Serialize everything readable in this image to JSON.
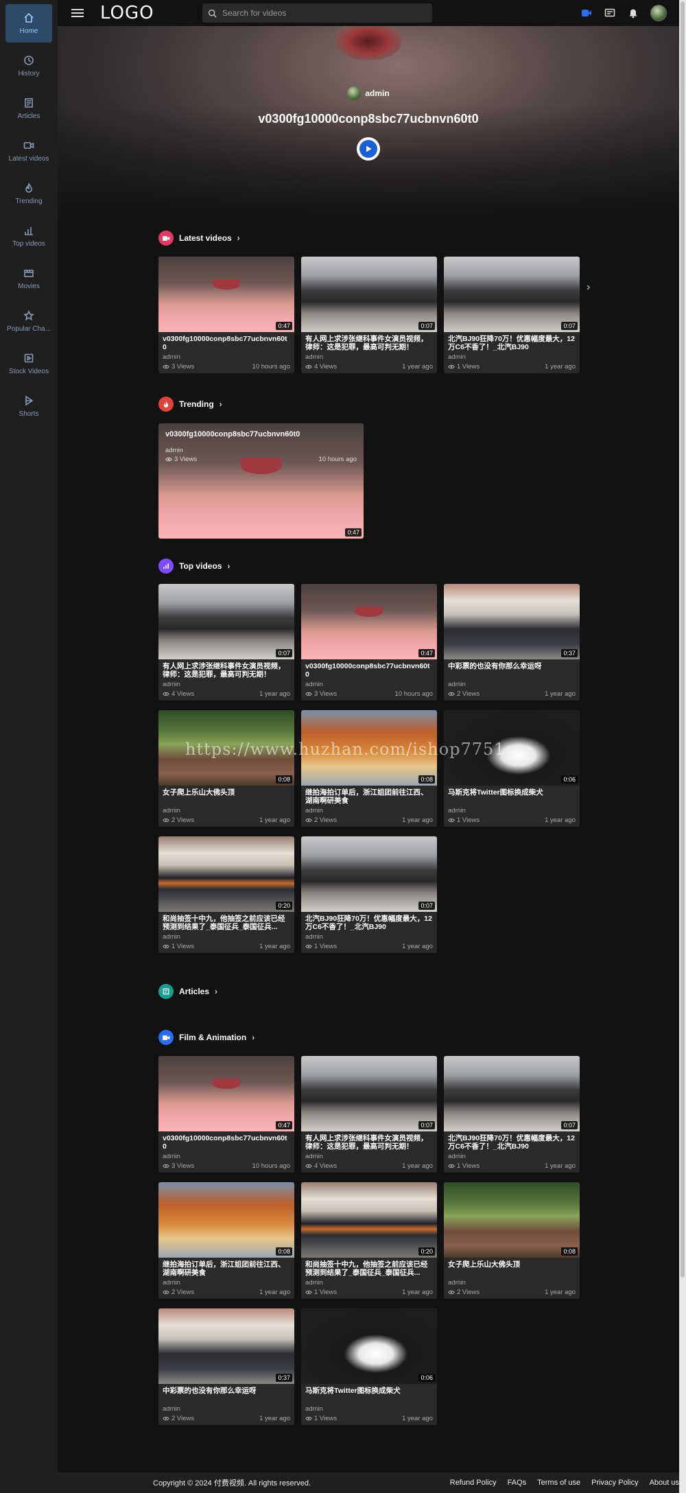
{
  "header": {
    "logo": "LOGO",
    "search_placeholder": "Search for videos"
  },
  "sidebar": {
    "items": [
      {
        "label": "Home",
        "icon": "home-icon",
        "active": true
      },
      {
        "label": "History",
        "icon": "history-icon"
      },
      {
        "label": "Articles",
        "icon": "articles-icon"
      },
      {
        "label": "Latest videos",
        "icon": "camera-icon"
      },
      {
        "label": "Trending",
        "icon": "flame-icon"
      },
      {
        "label": "Top videos",
        "icon": "bar-chart-icon"
      },
      {
        "label": "Movies",
        "icon": "movie-icon"
      },
      {
        "label": "Popular Cha...",
        "icon": "star-icon"
      },
      {
        "label": "Stock Videos",
        "icon": "stock-icon"
      },
      {
        "label": "Shorts",
        "icon": "shorts-icon"
      }
    ]
  },
  "hero": {
    "author": "admin",
    "title": "v0300fg10000conp8sbc77ucbnvn60t0"
  },
  "sections": {
    "latest": "Latest videos",
    "trending": "Trending",
    "top": "Top videos",
    "articles": "Articles",
    "film": "Film & Animation"
  },
  "latest_videos": [
    {
      "title": "v0300fg10000conp8sbc77ucbnvn60t0",
      "author": "admin",
      "views": "3 Views",
      "time": "10 hours ago",
      "duration": "0:47",
      "thumb": "girl"
    },
    {
      "title": "有人网上求涉张继科事件女演员视频，律师：这是犯罪，最高可判无期！",
      "author": "admin",
      "views": "4 Views",
      "time": "1 year ago",
      "duration": "0:07",
      "thumb": "car"
    },
    {
      "title": "北汽BJ90狂降70万！优惠幅度最大，12万C6不香了！_北汽BJ90",
      "author": "admin",
      "views": "1 Views",
      "time": "1 year ago",
      "duration": "0:07",
      "thumb": "car"
    }
  ],
  "trending": {
    "title": "v0300fg10000conp8sbc77ucbnvn60t0",
    "author": "admin",
    "views": "3 Views",
    "time": "10 hours ago",
    "duration": "0:47"
  },
  "top_videos": [
    {
      "title": "有人网上求涉张继科事件女演员视频，律师：这是犯罪，最高可判无期！",
      "author": "admin",
      "views": "4 Views",
      "time": "1 year ago",
      "duration": "0:07",
      "thumb": "car"
    },
    {
      "title": "v0300fg10000conp8sbc77ucbnvn60t0",
      "author": "admin",
      "views": "3 Views",
      "time": "10 hours ago",
      "duration": "0:47",
      "thumb": "girl"
    },
    {
      "title": "中彩票的也没有你那么幸运呀",
      "author": "admin",
      "views": "2 Views",
      "time": "1 year ago",
      "duration": "0:37",
      "thumb": "crowd"
    },
    {
      "title": "女子爬上乐山大佛头顶",
      "author": "admin",
      "views": "2 Views",
      "time": "1 year ago",
      "duration": "0:08",
      "thumb": "rock"
    },
    {
      "title": "继拍海拍订单后，浙江姐团前往江西、湖南啊研美食",
      "author": "admin",
      "views": "2 Views",
      "time": "1 year ago",
      "duration": "0:08",
      "thumb": "food"
    },
    {
      "title": "马斯克将Twitter图标换成柴犬",
      "author": "admin",
      "views": "1 Views",
      "time": "1 year ago",
      "duration": "0:06",
      "thumb": "suit"
    },
    {
      "title": "和尚抽签十中九，他抽签之前应该已经预测到结果了_泰国征兵_泰国征兵...",
      "author": "admin",
      "views": "1 Views",
      "time": "1 year ago",
      "duration": "0:20",
      "thumb": "monk"
    },
    {
      "title": "北汽BJ90狂降70万！优惠幅度最大，12万C6不香了！_北汽BJ90",
      "author": "admin",
      "views": "1 Views",
      "time": "1 year ago",
      "duration": "0:07",
      "thumb": "car"
    }
  ],
  "film_videos": [
    {
      "title": "v0300fg10000conp8sbc77ucbnvn60t0",
      "author": "admin",
      "views": "3 Views",
      "time": "10 hours ago",
      "duration": "0:47",
      "thumb": "girl"
    },
    {
      "title": "有人网上求涉张继科事件女演员视频，律师：这是犯罪，最高可判无期！",
      "author": "admin",
      "views": "4 Views",
      "time": "1 year ago",
      "duration": "0:07",
      "thumb": "car"
    },
    {
      "title": "北汽BJ90狂降70万！优惠幅度最大，12万C6不香了！_北汽BJ90",
      "author": "admin",
      "views": "1 Views",
      "time": "1 year ago",
      "duration": "0:07",
      "thumb": "car"
    },
    {
      "title": "继拍海拍订单后，浙江姐团前往江西、湖南啊研美食",
      "author": "admin",
      "views": "2 Views",
      "time": "1 year ago",
      "duration": "0:08",
      "thumb": "food"
    },
    {
      "title": "和尚抽签十中九，他抽签之前应该已经预测到结果了_泰国征兵_泰国征兵...",
      "author": "admin",
      "views": "1 Views",
      "time": "1 year ago",
      "duration": "0:20",
      "thumb": "monk"
    },
    {
      "title": "女子爬上乐山大佛头顶",
      "author": "admin",
      "views": "2 Views",
      "time": "1 year ago",
      "duration": "0:08",
      "thumb": "rock"
    },
    {
      "title": "中彩票的也没有你那么幸运呀",
      "author": "admin",
      "views": "2 Views",
      "time": "1 year ago",
      "duration": "0:37",
      "thumb": "crowd"
    },
    {
      "title": "马斯克将Twitter图标换成柴犬",
      "author": "admin",
      "views": "1 Views",
      "time": "1 year ago",
      "duration": "0:06",
      "thumb": "suit"
    }
  ],
  "watermark": "https://www.huzhan.com/ishop7751",
  "footer": {
    "copyright": "Copyright © 2024 付费视频. All rights reserved.",
    "links": [
      "Refund Policy",
      "FAQs",
      "Terms of use",
      "Privacy Policy",
      "About us"
    ]
  },
  "colors": {
    "accent": "#1d5fd6",
    "latest_icon": "#e53965",
    "trending_icon": "#e0443e",
    "top_icon": "#7c4dff",
    "articles_icon": "#1a9e8f",
    "film_icon": "#2b6cf0"
  }
}
